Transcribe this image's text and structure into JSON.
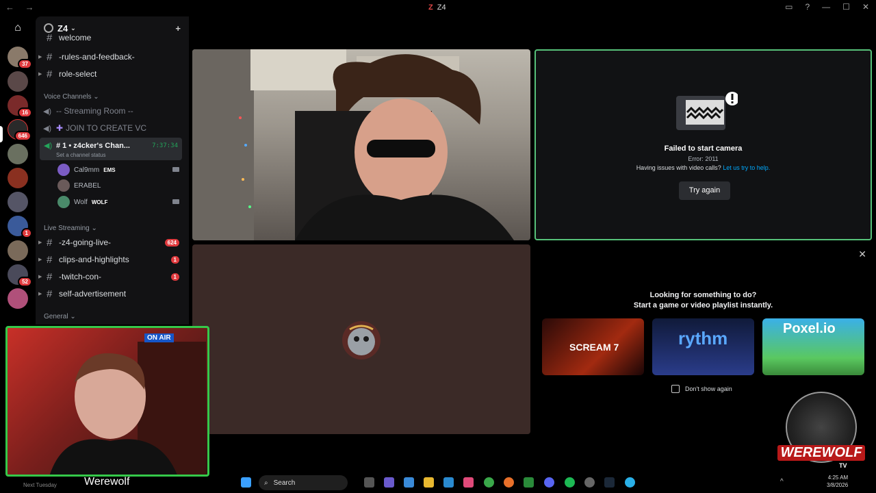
{
  "window": {
    "title": "Z4"
  },
  "rail": {
    "badges": [
      "37",
      "16",
      "646",
      "1",
      "52"
    ]
  },
  "sidebar": {
    "server_name": "Z4",
    "channels_top": [
      {
        "name": "welcome"
      },
      {
        "name": "-rules-and-feedback-"
      },
      {
        "name": "role-select"
      }
    ],
    "voice_category": "Voice Channels",
    "voice_channels": [
      {
        "name": "-- Streaming Room --"
      },
      {
        "name": "JOIN TO CREATE VC"
      }
    ],
    "active_vc": {
      "name": "# 1 • z4cker's Chan...",
      "time": "7:37:34",
      "status": "Set a channel status"
    },
    "members": [
      {
        "name": "Cal9mm",
        "tag": "EMS"
      },
      {
        "name": "ERABEL",
        "tag": ""
      },
      {
        "name": "Wolf",
        "tag": "WOLF"
      }
    ],
    "live_category": "Live Streaming",
    "live_channels": [
      {
        "name": "-z4-going-live-",
        "count": "624"
      },
      {
        "name": "clips-and-highlights",
        "count": "1"
      },
      {
        "name": "-twitch-con-",
        "count": "1"
      },
      {
        "name": "self-advertisement",
        "count": ""
      }
    ],
    "general_category": "General"
  },
  "camera_error": {
    "title": "Failed to start camera",
    "code": "Error: 2011",
    "help_text": "Having issues with video calls?",
    "help_link": "Let us try to help.",
    "button": "Try again"
  },
  "activity": {
    "line1": "Looking for something to do?",
    "line2": "Start a game or video playlist instantly.",
    "cards": [
      "SCREAM 7",
      "rythm",
      "Poxel.io"
    ],
    "dont_show": "Don't show again"
  },
  "webcam": {
    "on_air": "ON AIR",
    "name": "Werewolf",
    "bottom_text": "Next Tuesday"
  },
  "taskbar": {
    "search": "Search",
    "time": "4:25 AM",
    "date": "3/8/2026"
  },
  "logo": {
    "text": "WEREWOLF",
    "sub": "TV"
  }
}
